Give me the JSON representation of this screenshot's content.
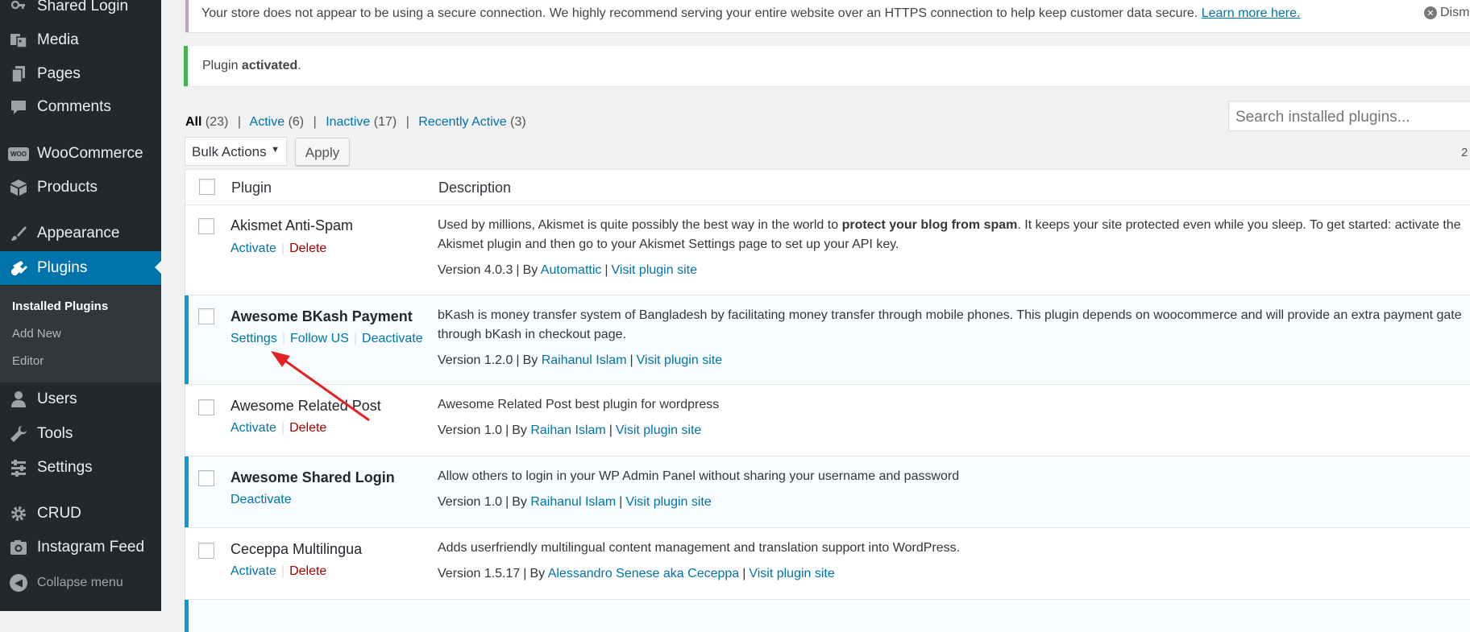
{
  "sidebar": {
    "items": [
      {
        "label": "Shared Login",
        "icon": "key-icon"
      },
      {
        "label": "Media",
        "icon": "media-icon"
      },
      {
        "label": "Pages",
        "icon": "pages-icon"
      },
      {
        "label": "Comments",
        "icon": "comments-icon"
      },
      {
        "label": "WooCommerce",
        "icon": "woocommerce-icon"
      },
      {
        "label": "Products",
        "icon": "products-icon"
      },
      {
        "label": "Appearance",
        "icon": "appearance-icon"
      },
      {
        "label": "Plugins",
        "icon": "plugins-icon"
      },
      {
        "label": "Users",
        "icon": "users-icon"
      },
      {
        "label": "Tools",
        "icon": "tools-icon"
      },
      {
        "label": "Settings",
        "icon": "settings-icon"
      },
      {
        "label": "CRUD",
        "icon": "gear-icon"
      },
      {
        "label": "Instagram Feed",
        "icon": "instagram-icon"
      }
    ],
    "submenu": [
      "Installed Plugins",
      "Add New",
      "Editor"
    ],
    "collapse": "Collapse menu",
    "woo_badge": "WOO"
  },
  "notices": {
    "https_text": "Your store does not appear to be using a secure connection. We highly recommend serving your entire website over an HTTPS connection to help keep customer data secure.",
    "https_link": "Learn more here.",
    "dismiss": "Dism",
    "activated_prefix": "Plugin ",
    "activated_bold": "activated",
    "activated_suffix": "."
  },
  "filters": {
    "all": "All",
    "all_count": "(23)",
    "active": "Active",
    "active_count": "(6)",
    "inactive": "Inactive",
    "inactive_count": "(17)",
    "recent": "Recently Active",
    "recent_count": "(3)",
    "sep": "|"
  },
  "search": {
    "placeholder": "Search installed plugins..."
  },
  "bulk": {
    "label": "Bulk Actions",
    "apply": "Apply",
    "count": "2"
  },
  "table": {
    "col_plugin": "Plugin",
    "col_description": "Description",
    "sep": "|",
    "by": "By",
    "rows": [
      {
        "name": "Akismet Anti-Spam",
        "act1": "Activate",
        "act2": "Delete",
        "desc1_a": "Used by millions, Akismet is quite possibly the best way in the world to ",
        "desc1_b": "protect your blog from spam",
        "desc1_c": ". It keeps your site protected even while you sleep. To get started: activate the",
        "desc2": "Akismet plugin and then go to your Akismet Settings page to set up your API key.",
        "version": "Version 4.0.3",
        "author": "Automattic",
        "visit": "Visit plugin site"
      },
      {
        "name": "Awesome BKash Payment",
        "act1": "Settings",
        "act2": "Follow US",
        "act3": "Deactivate",
        "desc1": "bKash is money transfer system of Bangladesh by facilitating money transfer through mobile phones. This plugin depends on woocommerce and will provide an extra payment gate",
        "desc2": "through bKash in checkout page.",
        "version": "Version 1.2.0",
        "author": "Raihanul Islam",
        "visit": "Visit plugin site"
      },
      {
        "name": "Awesome Related Post",
        "act1": "Activate",
        "act2": "Delete",
        "desc1": "Awesome Related Post best plugin for wordpress",
        "version": "Version 1.0",
        "author": "Raihan Islam",
        "visit": "Visit plugin site"
      },
      {
        "name": "Awesome Shared Login",
        "act1": "Deactivate",
        "desc1": "Allow others to login in your WP Admin Panel without sharing your username and password",
        "version": "Version 1.0",
        "author": "Raihanul Islam",
        "visit": "Visit plugin site"
      },
      {
        "name": "Ceceppa Multilingua",
        "act1": "Activate",
        "act2": "Delete",
        "desc1": "Adds userfriendly multilingual content management and translation support into WordPress.",
        "version": "Version 1.5.17",
        "author": "Alessandro Senese aka Ceceppa",
        "visit": "Visit plugin site"
      }
    ]
  },
  "colors": {
    "sidebar_bg": "#23282d",
    "accent": "#0073aa",
    "active_border": "#00a0d2",
    "success": "#46b450",
    "delete": "#aa0000",
    "annotation_arrow": "#e32222"
  }
}
